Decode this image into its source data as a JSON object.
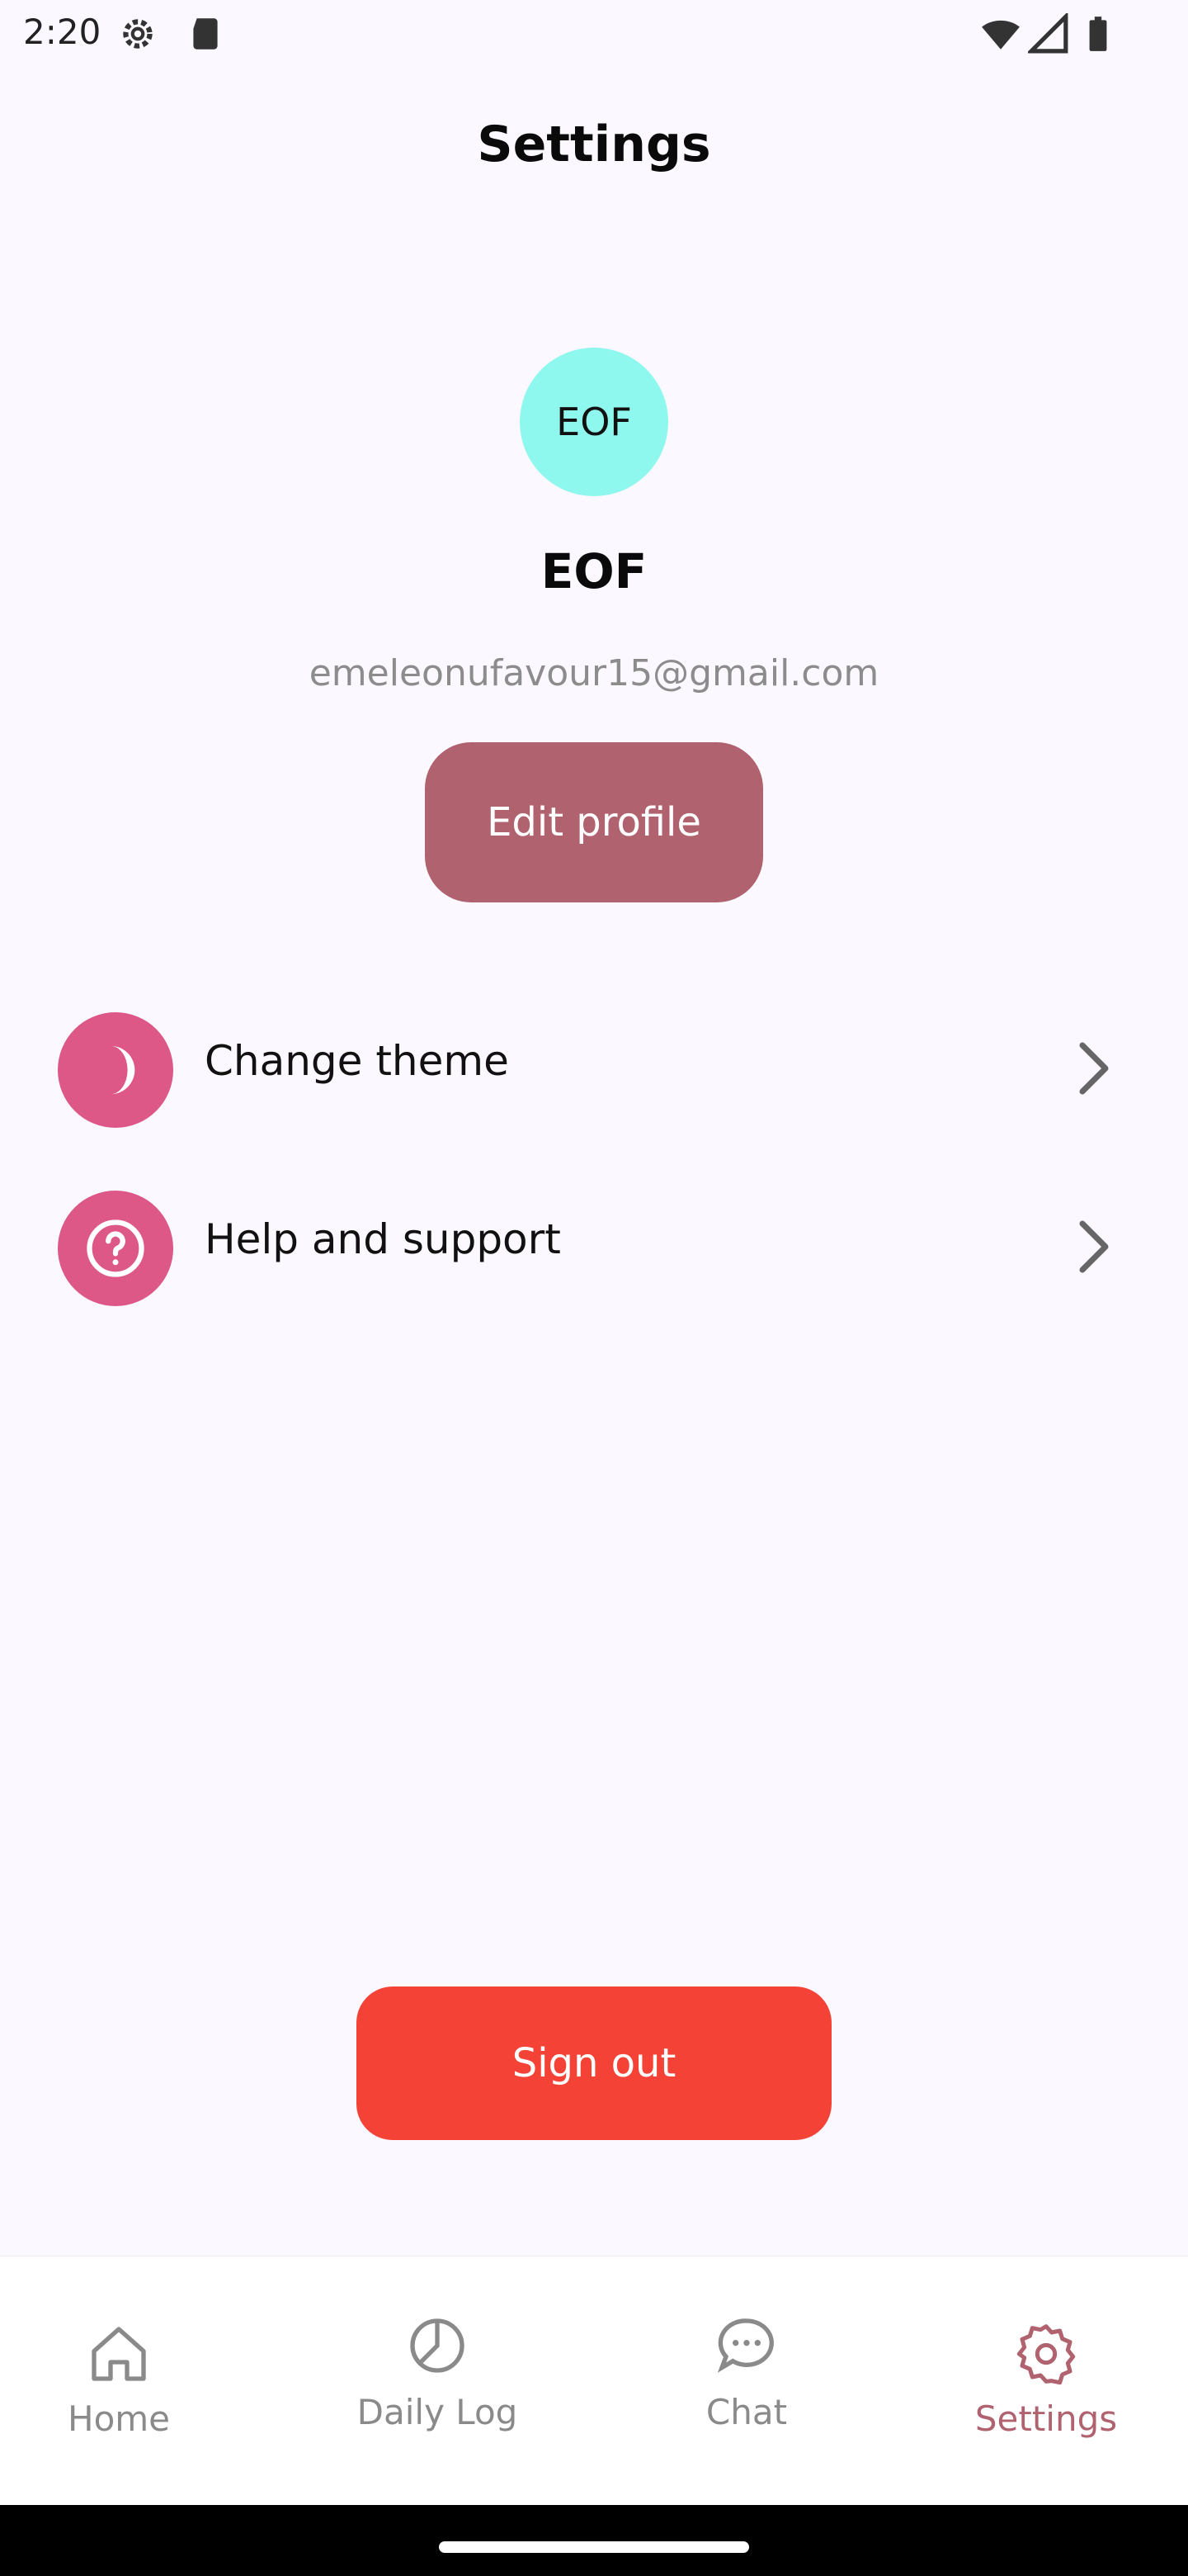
{
  "status_bar": {
    "time": "2:20"
  },
  "header": {
    "title": "Settings"
  },
  "profile": {
    "avatar_initials": "EOF",
    "name": "EOF",
    "email": "emeleonufavour15@gmail.com",
    "edit_label": "Edit profile"
  },
  "settings_items": [
    {
      "label": "Change theme",
      "icon": "moon-icon"
    },
    {
      "label": "Help and support",
      "icon": "help-icon"
    }
  ],
  "sign_out_label": "Sign out",
  "bottom_nav": [
    {
      "label": "Home",
      "icon": "home-icon",
      "active": false
    },
    {
      "label": "Daily Log",
      "icon": "pie-chart-icon",
      "active": false
    },
    {
      "label": "Chat",
      "icon": "chat-icon",
      "active": false
    },
    {
      "label": "Settings",
      "icon": "gear-icon",
      "active": true
    }
  ],
  "colors": {
    "background": "#fbf8ff",
    "avatar": "#8ff8ee",
    "edit_button": "#b0636f",
    "row_icon": "#dd5787",
    "sign_out": "#f44336",
    "nav_active": "#b0636f",
    "nav_inactive": "#8a8a8a"
  }
}
